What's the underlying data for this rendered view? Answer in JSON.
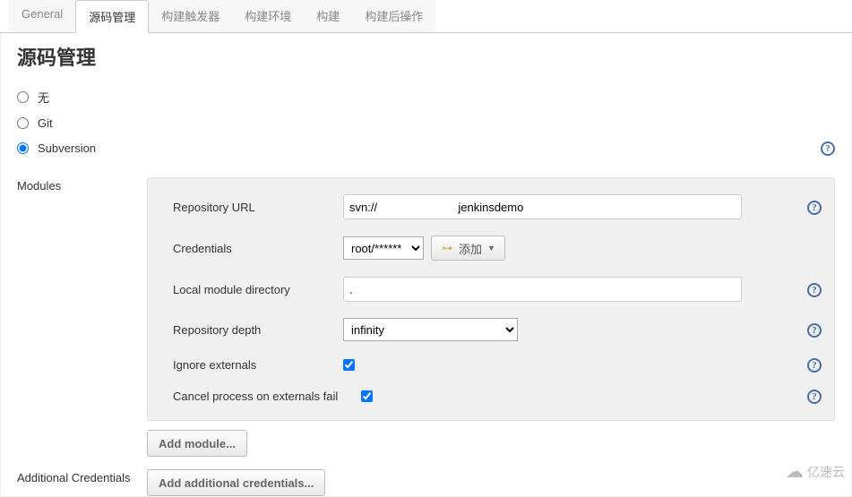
{
  "tabs": {
    "general": "General",
    "scm": "源码管理",
    "triggers": "构建触发器",
    "env": "构建环境",
    "build": "构建",
    "post": "构建后操作"
  },
  "section_title": "源码管理",
  "scm_options": {
    "none": "无",
    "git": "Git",
    "svn": "Subversion"
  },
  "modules_label": "Modules",
  "fields": {
    "repo_url_label": "Repository URL",
    "repo_url_value": "svn://                         jenkinsdemo",
    "credentials_label": "Credentials",
    "credentials_value": "root/******",
    "add_btn": "添加",
    "local_dir_label": "Local module directory",
    "local_dir_value": ".",
    "depth_label": "Repository depth",
    "depth_value": "infinity",
    "ignore_ext_label": "Ignore externals",
    "cancel_ext_label": "Cancel process on externals fail"
  },
  "buttons": {
    "add_module": "Add module...",
    "add_credentials": "Add additional credentials..."
  },
  "additional_credentials_label": "Additional Credentials",
  "watermark": "亿速云"
}
